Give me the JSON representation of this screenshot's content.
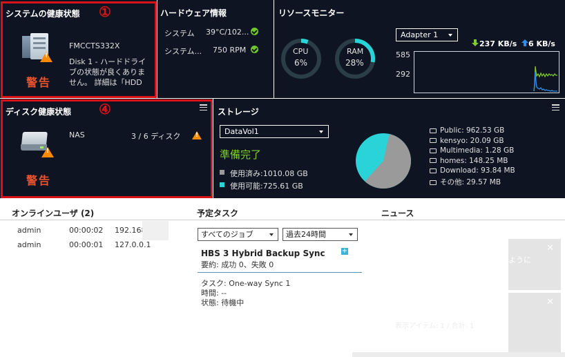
{
  "system_health": {
    "title": "システムの健康状態",
    "device_name": "FMCCTS332X",
    "message": [
      "Disk 1 - ハードドライ",
      "ブの状態が良くありま",
      "せん。 詳細は「HDD"
    ],
    "status": "警告",
    "annotation": "①"
  },
  "hardware": {
    "title": "ハードウェア情報",
    "rows": [
      {
        "label": "システム",
        "value": "39°C/102..."
      },
      {
        "label": "システム...",
        "value": "750 RPM"
      }
    ]
  },
  "resource": {
    "title": "リソースモニター",
    "cpu": {
      "label": "CPU",
      "percent": 6,
      "text": "6%"
    },
    "ram": {
      "label": "RAM",
      "percent": 28,
      "text": "28%"
    },
    "adapter": "Adapter 1",
    "download": "237 KB/s",
    "upload": "6 KB/s",
    "y_ticks": [
      "585",
      "292"
    ],
    "colors": {
      "ring": "#29d3d8",
      "download": "#7ec832",
      "upload": "#2c8fe8"
    }
  },
  "disk_health": {
    "title": "ディスク健康状態",
    "label": "NAS",
    "count": "3 / 6 ディスク",
    "status": "警告",
    "annotation": "④"
  },
  "storage": {
    "title": "ストレージ",
    "volume": "DataVol1",
    "state": "準備完了",
    "used": "使用済み:1010.08 GB",
    "free": "使用可能:725.61 GB",
    "used_fraction": 0.582,
    "folders": [
      "Public: 962.53 GB",
      "kensyo: 20.09 GB",
      "Multimedia: 1.28 GB",
      "homes: 148.25 MB",
      "Download: 93.84 MB",
      "その他: 29.57 MB"
    ]
  },
  "online_users": {
    "title": "オンラインユーザ (2)",
    "rows": [
      {
        "user": "admin",
        "time": "00:00:02",
        "ip": "192.168"
      },
      {
        "user": "admin",
        "time": "00:00:01",
        "ip": "127.0.0.1"
      }
    ]
  },
  "tasks": {
    "title": "予定タスク",
    "filter_job": "すべてのジョブ",
    "filter_time": "過去24時間",
    "job_name": "HBS 3 Hybrid Backup Sync",
    "summary": "要約: 成功 0、失敗 0",
    "task": "タスク: One-way Sync 1",
    "time": "時間: --",
    "status": "状態: 待機中"
  },
  "news": {
    "title": "ニュース",
    "item_text": "ように",
    "footer_text": "表示アイテム: 1 / 合計: 1"
  }
}
